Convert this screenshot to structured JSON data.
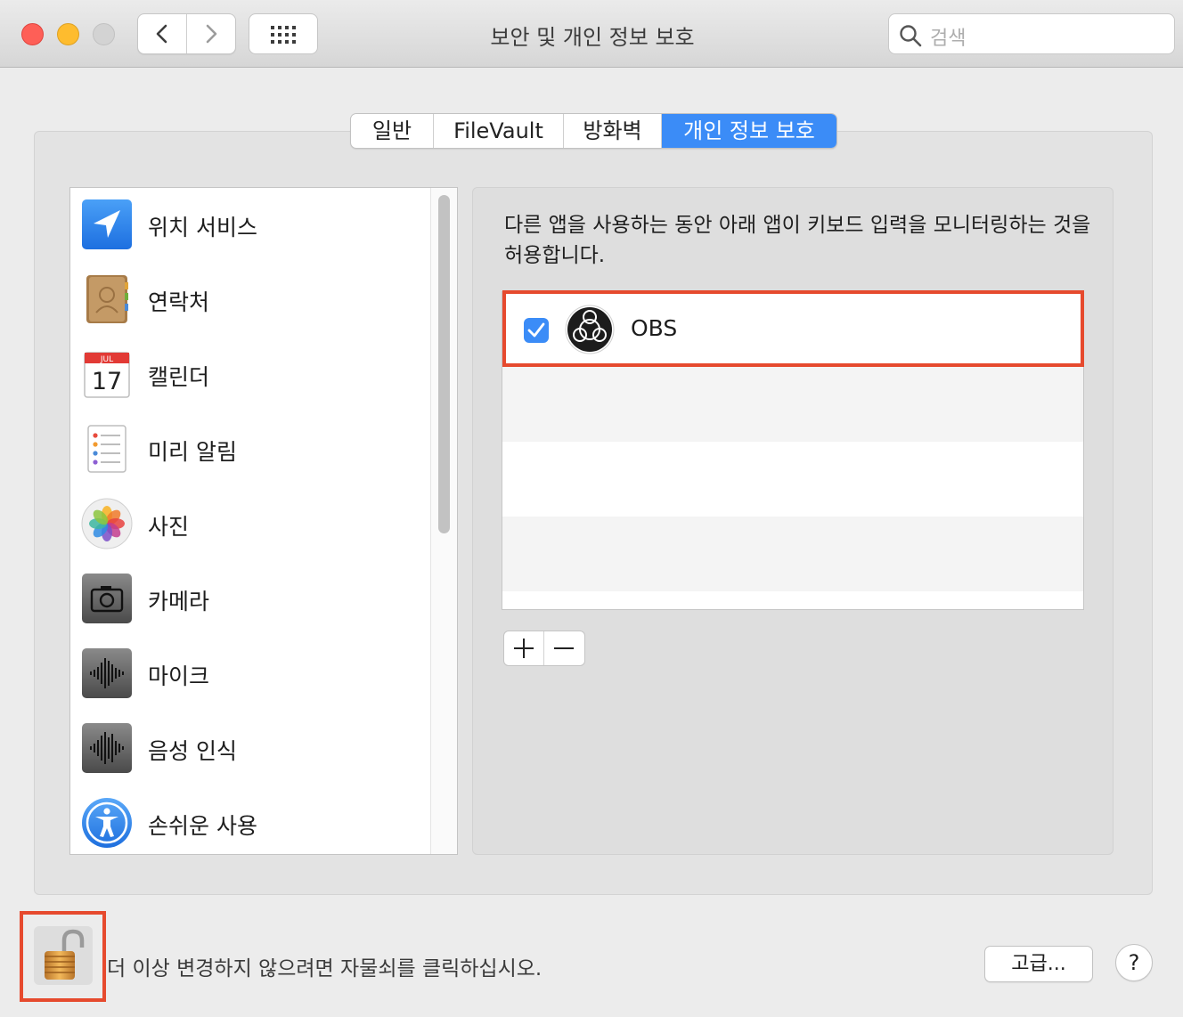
{
  "window": {
    "title": "보안 및 개인 정보 보호",
    "search_placeholder": "검색"
  },
  "tabs": [
    {
      "label": "일반",
      "selected": false
    },
    {
      "label": "FileVault",
      "selected": false
    },
    {
      "label": "방화벽",
      "selected": false
    },
    {
      "label": "개인 정보 보호",
      "selected": true
    }
  ],
  "sidebar": {
    "items": [
      {
        "label": "위치 서비스",
        "icon": "location-arrow-icon"
      },
      {
        "label": "연락처",
        "icon": "contacts-book-icon"
      },
      {
        "label": "캘린더",
        "icon": "calendar-icon",
        "icon_month": "JUL",
        "icon_day": "17"
      },
      {
        "label": "미리 알림",
        "icon": "reminders-icon"
      },
      {
        "label": "사진",
        "icon": "photos-flower-icon"
      },
      {
        "label": "카메라",
        "icon": "camera-icon"
      },
      {
        "label": "마이크",
        "icon": "microphone-waveform-icon"
      },
      {
        "label": "음성 인식",
        "icon": "speech-recognition-icon"
      },
      {
        "label": "손쉬운 사용",
        "icon": "accessibility-icon"
      }
    ]
  },
  "detail": {
    "description": "다른 앱을 사용하는 동안 아래 앱이 키보드 입력을 모니터링하는 것을 허용합니다.",
    "apps": [
      {
        "name": "OBS",
        "checked": true,
        "icon": "obs-icon"
      }
    ],
    "add_label": "+",
    "remove_label": "−"
  },
  "footer": {
    "lock_text": "더 이상 변경하지 않으려면 자물쇠를 클릭하십시오.",
    "advanced_label": "고급...",
    "help_label": "?"
  },
  "colors": {
    "accent": "#3b8cf7",
    "highlight_border": "#e64a2e"
  }
}
